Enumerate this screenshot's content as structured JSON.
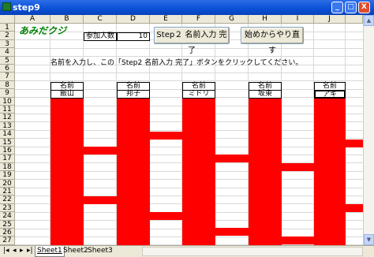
{
  "window": {
    "title": "step9",
    "min": "_",
    "max": "□",
    "close": "X"
  },
  "columns": [
    "A",
    "B",
    "C",
    "D",
    "E",
    "F",
    "G",
    "H",
    "I",
    "J"
  ],
  "rows": [
    "1",
    "2",
    "3",
    "4",
    "5",
    "6",
    "7",
    "8",
    "9",
    "10",
    "11",
    "12",
    "13",
    "14",
    "15",
    "16",
    "17",
    "18",
    "19",
    "20",
    "21",
    "22",
    "23",
    "24",
    "25",
    "26",
    "27"
  ],
  "title_text": "あみだクジ",
  "participants": {
    "label": "参加人数",
    "value": "10"
  },
  "buttons": {
    "step2": "Step２ 名前入力 完了",
    "restart": "始めからやり直す"
  },
  "instruction": "名前を入力し、この「Step2 名前入力 完了」ボタンをクリックしてください。",
  "name_header": "名前",
  "names": [
    "飯山",
    "邦子",
    "ミドリ",
    "坂東",
    "アキ"
  ],
  "colors": {
    "ladder": "#ff0000",
    "title": "#008000"
  },
  "tabs": [
    "Sheet1",
    "Sheet2",
    "Sheet3"
  ],
  "tab_nav": [
    "|◂",
    "◂",
    "▸",
    "▸|"
  ]
}
